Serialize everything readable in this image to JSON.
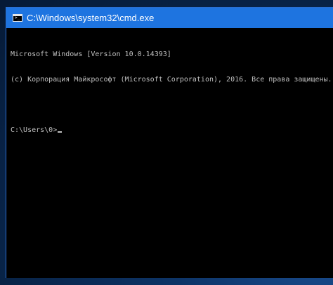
{
  "window": {
    "title": "C:\\Windows\\system32\\cmd.exe",
    "icon": "cmd-console-icon"
  },
  "console": {
    "lines": [
      "Microsoft Windows [Version 10.0.14393]",
      "(c) Корпорация Майкрософт (Microsoft Corporation), 2016. Все права защищены.",
      "",
      "C:\\Users\\0>"
    ]
  },
  "colors": {
    "titlebar": "#1e74e0",
    "console_bg": "#000000",
    "console_text": "#c0c0c0"
  }
}
